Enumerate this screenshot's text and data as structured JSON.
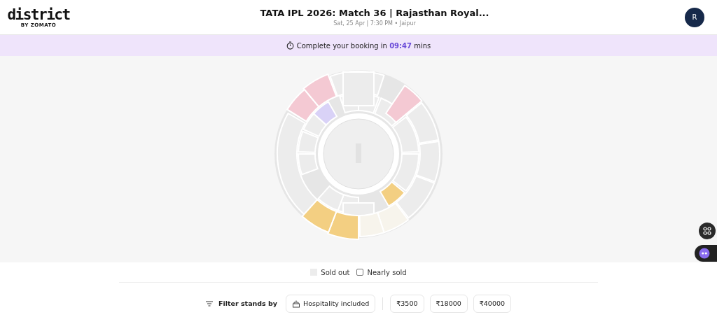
{
  "header": {
    "logo": "district",
    "logo_sub": "BY ZOMATO",
    "title": "TATA IPL 2026: Match 36 | Rajasthan Royal...",
    "subtitle": "Sat, 25 Apr | 7:30 PM • Jaipur",
    "avatar": "R"
  },
  "timer": {
    "text": "Complete your booking in",
    "time": "09:47",
    "unit": "mins"
  },
  "stands": [
    {
      "color": "#f4c9d3"
    },
    {
      "color": "#f4c9d3"
    },
    {
      "color": "#f4c9d3"
    },
    {
      "color": "#d9d2f7"
    },
    {
      "color": "#f3cf82"
    },
    {
      "color": "#f3cf82"
    },
    {
      "color": "#f3cf82"
    },
    {
      "color": "#f7f4ec"
    },
    {
      "color": "#f7f4ec"
    }
  ],
  "legend": [
    {
      "kind": "sold",
      "label": "Sold out"
    },
    {
      "kind": "nearly",
      "label": "Nearly sold"
    }
  ],
  "filter": {
    "label": "Filter stands by",
    "chips": [
      {
        "kind": "hospitality",
        "label": "Hospitality included"
      },
      {
        "kind": "price",
        "label": "₹3500"
      },
      {
        "kind": "price",
        "label": "₹18000"
      },
      {
        "kind": "price",
        "label": "₹40000"
      }
    ]
  }
}
